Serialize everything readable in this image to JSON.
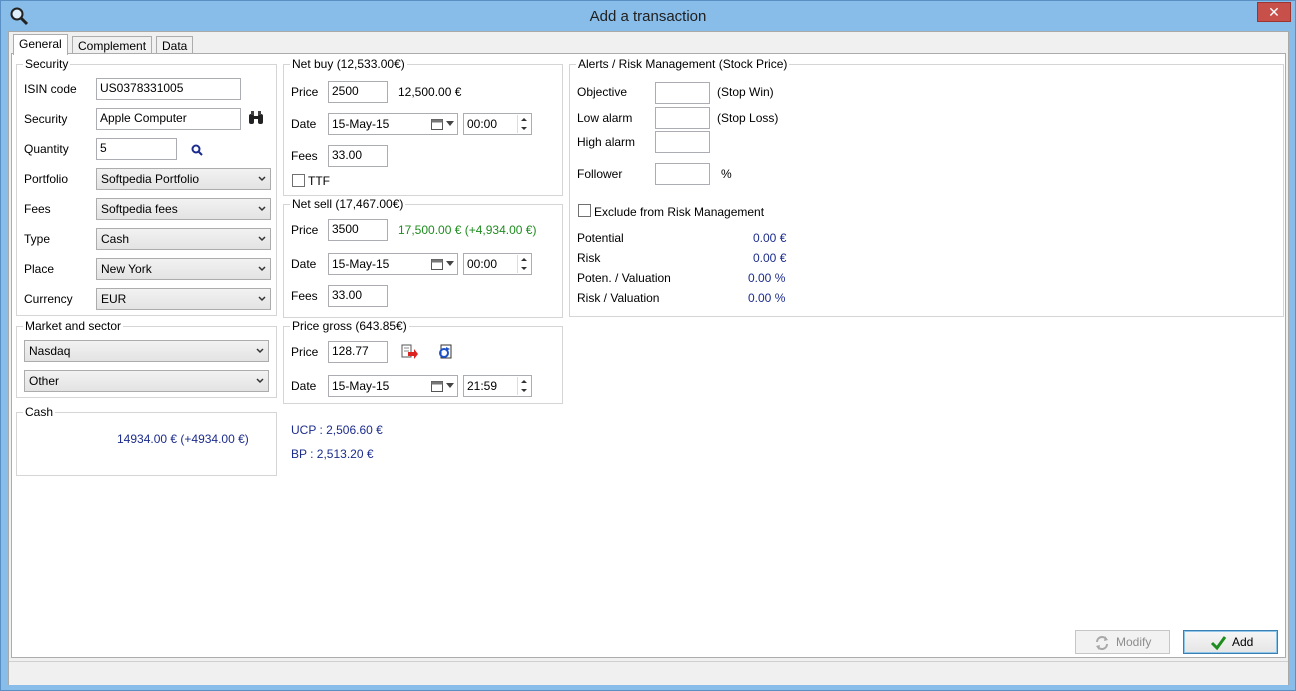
{
  "window": {
    "title": "Add a transaction",
    "close_label": "✕"
  },
  "tabs": [
    {
      "label": "General",
      "active": true
    },
    {
      "label": "Complement",
      "active": false
    },
    {
      "label": "Data",
      "active": false
    }
  ],
  "security": {
    "legend": "Security",
    "isin_label": "ISIN code",
    "isin_value": "US0378331005",
    "security_label": "Security",
    "security_value": "Apple Computer",
    "quantity_label": "Quantity",
    "quantity_value": "5",
    "portfolio_label": "Portfolio",
    "portfolio_value": "Softpedia Portfolio",
    "fees_label": "Fees",
    "fees_value": "Softpedia fees",
    "type_label": "Type",
    "type_value": "Cash",
    "place_label": "Place",
    "place_value": "New York",
    "currency_label": "Currency",
    "currency_value": "EUR"
  },
  "market": {
    "legend": "Market and sector",
    "market_value": "Nasdaq",
    "sector_value": "Other"
  },
  "cash": {
    "legend": "Cash",
    "value": "14934.00 € (+4934.00 €)"
  },
  "net_buy": {
    "legend": "Net buy (12,533.00€)",
    "price_label": "Price",
    "price_value": "2500",
    "price_total": "12,500.00 €",
    "date_label": "Date",
    "date_value": "15-May-15",
    "time_value": "00:00",
    "fees_label": "Fees",
    "fees_value": "33.00",
    "ttf_label": "TTF"
  },
  "net_sell": {
    "legend": "Net sell (17,467.00€)",
    "price_label": "Price",
    "price_value": "3500",
    "price_total": "17,500.00 € (+4,934.00 €)",
    "date_label": "Date",
    "date_value": "15-May-15",
    "time_value": "00:00",
    "fees_label": "Fees",
    "fees_value": "33.00"
  },
  "price_gross": {
    "legend": "Price gross (643.85€)",
    "price_label": "Price",
    "price_value": "128.77",
    "date_label": "Date",
    "date_value": "15-May-15",
    "time_value": "21:59"
  },
  "summary": {
    "ucp": "UCP : 2,506.60 €",
    "bp": "BP : 2,513.20 €"
  },
  "alerts": {
    "legend": "Alerts / Risk Management (Stock Price)",
    "objective_label": "Objective",
    "objective_value": "",
    "stop_win_label": "(Stop Win)",
    "low_alarm_label": "Low alarm",
    "low_alarm_value": "",
    "stop_loss_label": "(Stop Loss)",
    "high_alarm_label": "High alarm",
    "high_alarm_value": "",
    "follower_label": "Follower",
    "follower_value": "",
    "percent_label": "%",
    "exclude_label": "Exclude from Risk Management",
    "potential_label": "Potential",
    "potential_value": "0.00 €",
    "risk_label": "Risk",
    "risk_value": "0.00 €",
    "poten_val_label": "Poten. / Valuation",
    "poten_val_value": "0.00 %",
    "risk_val_label": "Risk / Valuation",
    "risk_val_value": "0.00 %"
  },
  "buttons": {
    "modify_label": "Modify",
    "add_label": "Add"
  },
  "colors": {
    "accent_blue": "#1c2c8c",
    "gain_green": "#1e8c1e",
    "titlebar": "#88bde9"
  }
}
